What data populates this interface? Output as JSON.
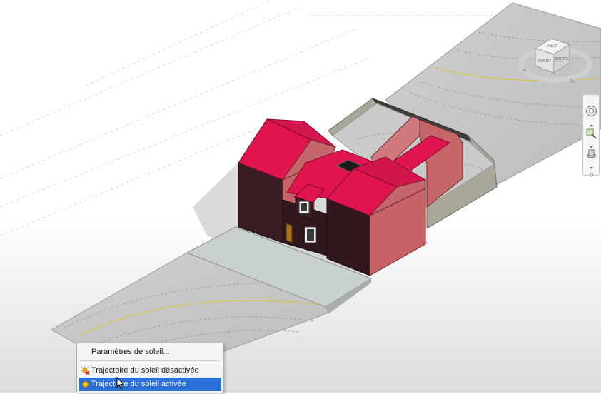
{
  "viewcube": {
    "top_face": "HAUT",
    "front_face": "AVANT",
    "right_face": "DROITE",
    "compass_marker": "N"
  },
  "context_menu": {
    "items": [
      {
        "label": "Paramètres de soleil...",
        "icon": "none",
        "highlighted": false
      },
      {
        "label": "Trajectoire du soleil désactivée",
        "icon": "sun-off-icon",
        "highlighted": false
      },
      {
        "label": "Trajectoire du soleil activée",
        "icon": "sun-on-icon",
        "highlighted": true
      }
    ]
  },
  "colors": {
    "roof": "#e0154f",
    "wall_dark": "#3a1d22",
    "wall_light": "#c96266",
    "site_wall": "#a9a797",
    "terrain": "#c6c6c6",
    "contour": "#d9c531",
    "menu_highlight": "#2a6fd6"
  }
}
